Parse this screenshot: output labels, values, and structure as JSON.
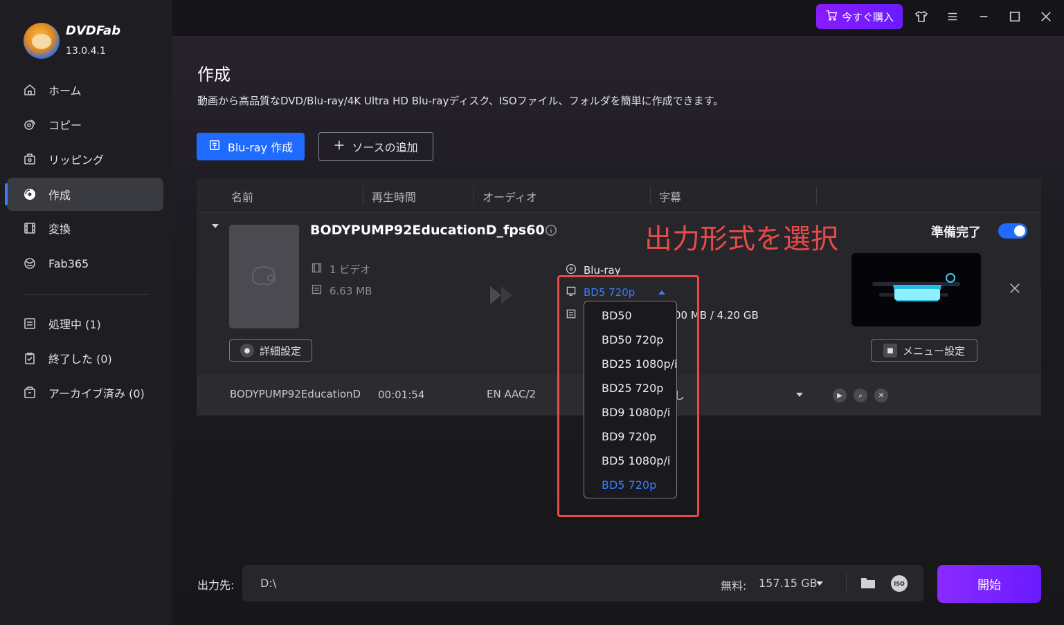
{
  "app": {
    "name": "DVDFab",
    "version": "13.0.4.1"
  },
  "sidebar": {
    "items": [
      {
        "label": "ホーム",
        "icon": "home-icon"
      },
      {
        "label": "コピー",
        "icon": "copy-icon"
      },
      {
        "label": "リッピング",
        "icon": "ripper-icon"
      },
      {
        "label": "作成",
        "icon": "creator-icon",
        "active": true
      },
      {
        "label": "変換",
        "icon": "convert-icon"
      },
      {
        "label": "Fab365",
        "icon": "fab365-icon"
      }
    ],
    "queue": [
      {
        "label": "処理中 (1)",
        "icon": "processing-icon"
      },
      {
        "label": "終了した (0)",
        "icon": "finished-icon"
      },
      {
        "label": "アーカイブ済み (0)",
        "icon": "archive-icon"
      }
    ]
  },
  "titlebar": {
    "buy_label": "今すぐ購入"
  },
  "header": {
    "title": "作成",
    "description": "動画から高品質なDVD/Blu-ray/4K Ultra HD Blu-rayディスク、ISOファイル、フォルダを簡単に作成できます。"
  },
  "toolbar": {
    "create_label": "Blu-ray 作成",
    "add_source_label": "ソースの追加"
  },
  "table": {
    "columns": [
      "名前",
      "再生時間",
      "オーディオ",
      "字幕"
    ],
    "item": {
      "title": "BODYPUMP92EducationD_fps60",
      "videos": "1 ビデオ",
      "size": "6.63 MB",
      "detail_settings": "詳細設定",
      "output_type": "Blu-ray",
      "output_quality": "BD5 720p",
      "size_ratio": "00 MB / 4.20 GB",
      "ready_label": "準備完了",
      "ready": true,
      "menu_settings": "メニュー設定"
    },
    "track": {
      "name": "BODYPUMP92EducationD",
      "duration": "00:01:54",
      "audio": "EN  AAC/2",
      "subtitle": "し"
    }
  },
  "dropdown": {
    "options": [
      "BD50",
      "BD50 720p",
      "BD25 1080p/i",
      "BD25 720p",
      "BD9 1080p/i",
      "BD9 720p",
      "BD5 1080p/i",
      "BD5 720p"
    ],
    "selected": "BD5 720p"
  },
  "annotation": "出力形式を選択",
  "footer": {
    "output_label": "出力先:",
    "path": "D:\\",
    "free_label": "無料:",
    "free_space": "157.15 GB",
    "start_label": "開始"
  },
  "colors": {
    "accent": "#1f6bff",
    "purple": "#7a1bff",
    "annotation": "#e84a4a"
  }
}
